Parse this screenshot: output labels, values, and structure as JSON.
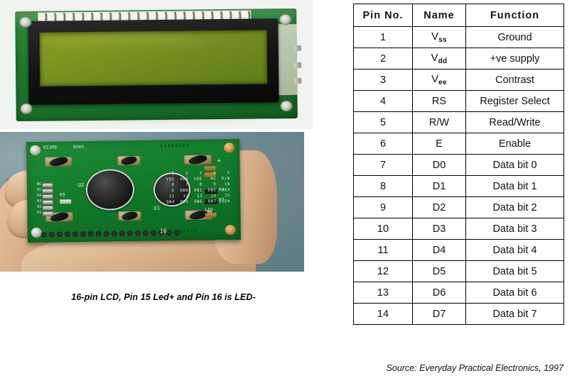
{
  "photos": {
    "front": {
      "alt_name": "lcd-front-photo",
      "board_color": "#1f7a2e",
      "screen_color": "#7d9520",
      "bezel_color": "#141414"
    },
    "rear": {
      "alt_name": "lcd-rear-in-hand-photo",
      "background_color": "#7d969b",
      "board_color": "#15812e",
      "silkscreen": {
        "marking": "653M8",
        "compliance": "ROHS",
        "chip_u1": "U1",
        "chip_u2": "U2",
        "resistors": [
          "R6",
          "R5",
          "R4",
          "R3",
          "R2",
          "R1"
        ],
        "resistor_side": "R9",
        "resistor_right_top": "R8",
        "resistor_right_bottom": "R7",
        "led_minus": "LED-",
        "led_plus": "+",
        "pin_count_mark": "16",
        "pin_map_rows": [
          "  1    2    3    4    5",
          "VSS  VDD  VEE   RS  R/W",
          "  6    7    8    9   10",
          "  E  DB0  DB1  DB2  DB3",
          " 11   12   13   14   15",
          "DB4  DB5  DB6  DB7 LEDA"
        ]
      }
    },
    "caption": "16-pin LCD, Pin 15 Led+ and Pin 16 is LED-"
  },
  "table": {
    "name": "lcd-pinout-table",
    "headers": [
      "Pin  No.",
      "Name",
      "Function"
    ],
    "rows": [
      {
        "pin": "1",
        "name": "V",
        "sub": "ss",
        "function": "Ground"
      },
      {
        "pin": "2",
        "name": "V",
        "sub": "dd",
        "function": "+ve supply"
      },
      {
        "pin": "3",
        "name": "V",
        "sub": "ee",
        "function": "Contrast"
      },
      {
        "pin": "4",
        "name": "RS",
        "sub": "",
        "function": "Register Select"
      },
      {
        "pin": "5",
        "name": "R/W",
        "sub": "",
        "function": "Read/Write"
      },
      {
        "pin": "6",
        "name": "E",
        "sub": "",
        "function": "Enable"
      },
      {
        "pin": "7",
        "name": "D0",
        "sub": "",
        "function": "Data bit 0"
      },
      {
        "pin": "8",
        "name": "D1",
        "sub": "",
        "function": "Data bit 1"
      },
      {
        "pin": "9",
        "name": "D2",
        "sub": "",
        "function": "Data bit 2"
      },
      {
        "pin": "10",
        "name": "D3",
        "sub": "",
        "function": "Data bit 3"
      },
      {
        "pin": "11",
        "name": "D4",
        "sub": "",
        "function": "Data bit 4"
      },
      {
        "pin": "12",
        "name": "D5",
        "sub": "",
        "function": "Data bit 5"
      },
      {
        "pin": "13",
        "name": "D6",
        "sub": "",
        "function": "Data bit 6"
      },
      {
        "pin": "14",
        "name": "D7",
        "sub": "",
        "function": "Data bit 7"
      }
    ]
  },
  "source_note": "Source: Everyday Practical Electronics, 1997"
}
